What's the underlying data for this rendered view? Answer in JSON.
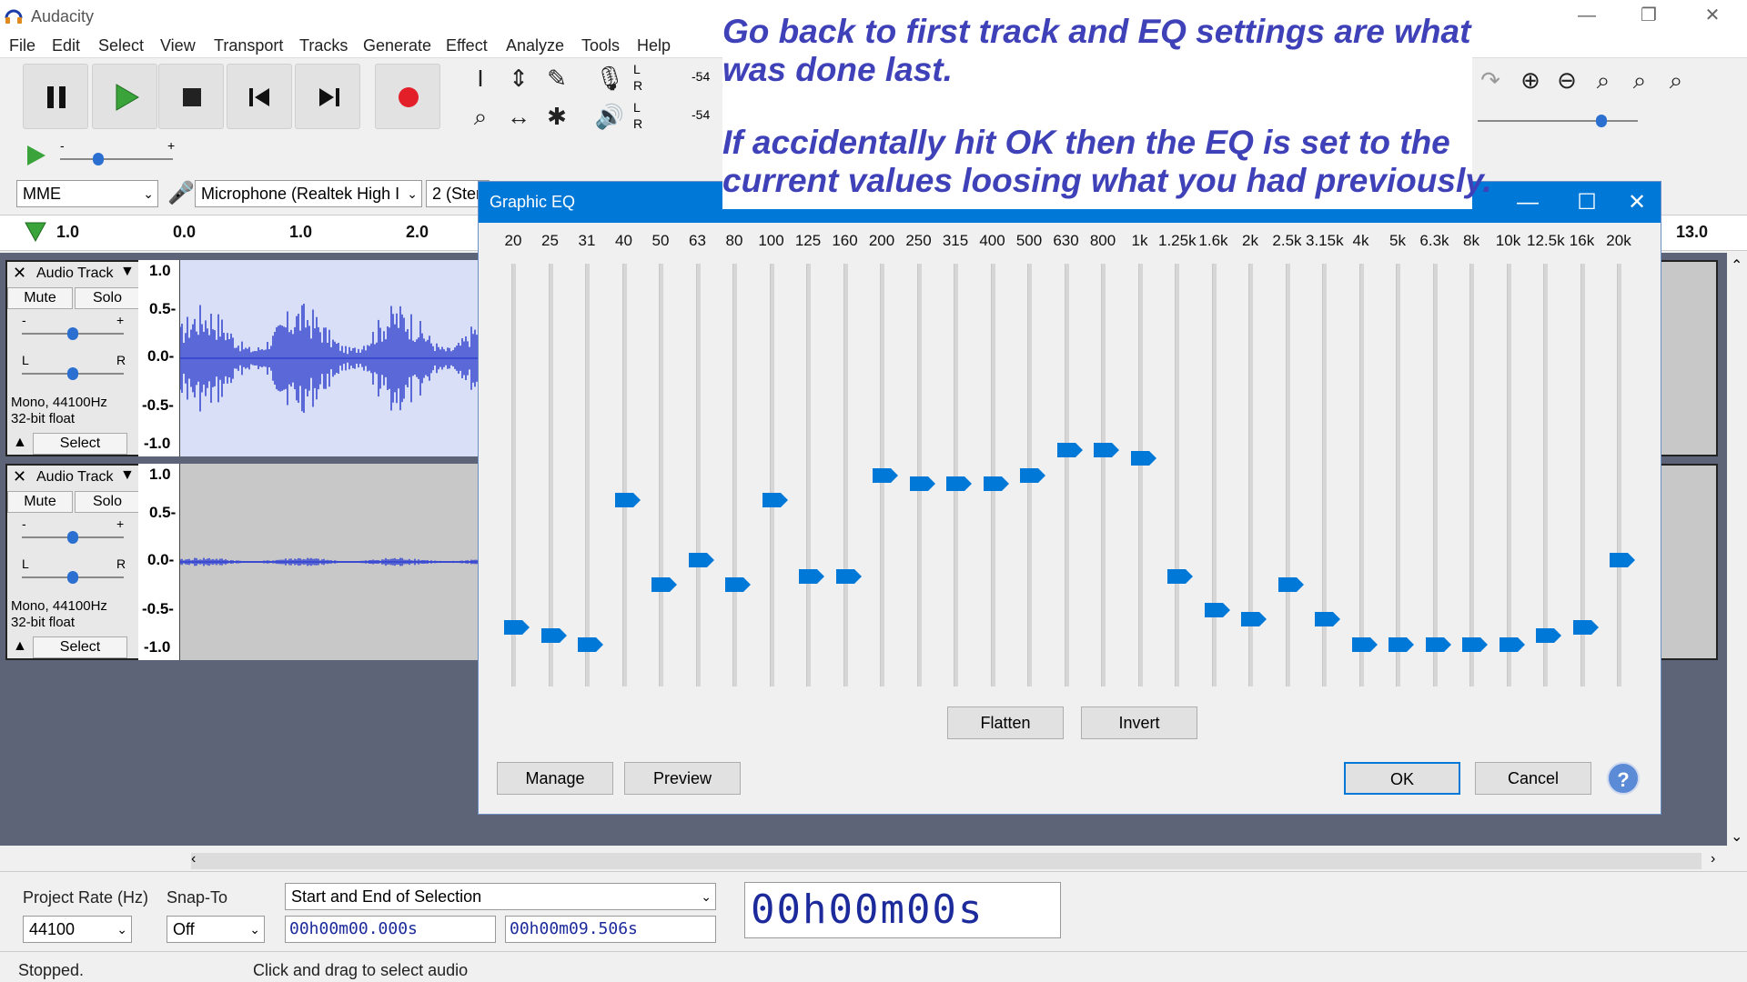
{
  "app": {
    "title": "Audacity"
  },
  "window_controls": {
    "minimize": "—",
    "restore": "❐",
    "close": "✕"
  },
  "menu": [
    "File",
    "Edit",
    "Select",
    "View",
    "Transport",
    "Tracks",
    "Generate",
    "Effect",
    "Analyze",
    "Tools",
    "Help"
  ],
  "meters": {
    "rec_level": "-54",
    "play_level": "-54",
    "L": "L",
    "R": "R"
  },
  "device": {
    "host": "MME",
    "mic": "Microphone (Realtek High I",
    "channels": "2 (Stere"
  },
  "ruler": {
    "labels": [
      "1.0",
      "0.0",
      "1.0",
      "2.0",
      "13.0"
    ]
  },
  "tracks": [
    {
      "name": "Audio Track",
      "mute": "Mute",
      "solo": "Solo",
      "info1": "Mono, 44100Hz",
      "info2": "32-bit float",
      "select": "Select",
      "y": [
        "1.0",
        "0.5-",
        "0.0-",
        "-0.5-",
        "-1.0"
      ]
    },
    {
      "name": "Audio Track",
      "mute": "Mute",
      "solo": "Solo",
      "info1": "Mono, 44100Hz",
      "info2": "32-bit float",
      "select": "Select",
      "y": [
        "1.0",
        "0.5-",
        "0.0-",
        "-0.5-",
        "-1.0"
      ]
    }
  ],
  "gain_slider": {
    "minus": "-",
    "plus": "+"
  },
  "pan_slider": {
    "L": "L",
    "R": "R"
  },
  "eq_dialog": {
    "title": "Graphic EQ",
    "controls": {
      "minimize": "—",
      "maximize": "☐",
      "close": "✕"
    },
    "bands": [
      {
        "label": "20",
        "level": 0.14
      },
      {
        "label": "25",
        "level": 0.12
      },
      {
        "label": "31",
        "level": 0.1
      },
      {
        "label": "40",
        "level": 0.44
      },
      {
        "label": "50",
        "level": 0.24
      },
      {
        "label": "63",
        "level": 0.3
      },
      {
        "label": "80",
        "level": 0.24
      },
      {
        "label": "100",
        "level": 0.44
      },
      {
        "label": "125",
        "level": 0.26
      },
      {
        "label": "160",
        "level": 0.26
      },
      {
        "label": "200",
        "level": 0.5
      },
      {
        "label": "250",
        "level": 0.48
      },
      {
        "label": "315",
        "level": 0.48
      },
      {
        "label": "400",
        "level": 0.48
      },
      {
        "label": "500",
        "level": 0.5
      },
      {
        "label": "630",
        "level": 0.56
      },
      {
        "label": "800",
        "level": 0.56
      },
      {
        "label": "1k",
        "level": 0.54
      },
      {
        "label": "1.25k",
        "level": 0.26
      },
      {
        "label": "1.6k",
        "level": 0.18
      },
      {
        "label": "2k",
        "level": 0.16
      },
      {
        "label": "2.5k",
        "level": 0.24
      },
      {
        "label": "3.15k",
        "level": 0.16
      },
      {
        "label": "4k",
        "level": 0.1
      },
      {
        "label": "5k",
        "level": 0.1
      },
      {
        "label": "6.3k",
        "level": 0.1
      },
      {
        "label": "8k",
        "level": 0.1
      },
      {
        "label": "10k",
        "level": 0.1
      },
      {
        "label": "12.5k",
        "level": 0.12
      },
      {
        "label": "16k",
        "level": 0.14
      },
      {
        "label": "20k",
        "level": 0.3
      }
    ],
    "flatten": "Flatten",
    "invert": "Invert",
    "manage": "Manage",
    "preview": "Preview",
    "ok": "OK",
    "cancel": "Cancel",
    "help": "?"
  },
  "annotation": {
    "line1": "Go back to first track and EQ settings are what",
    "line2": "was done last.",
    "line3": "If accidentally hit OK then the EQ is set to the",
    "line4": "current values loosing what you had previously."
  },
  "bottom": {
    "project_rate_label": "Project Rate (Hz)",
    "project_rate": "44100",
    "snap_label": "Snap-To",
    "snap": "Off",
    "selection_mode": "Start and End of Selection",
    "start_time": "00h00m00.000s",
    "end_time": "00h00m09.506s",
    "big_time": "00h00m00s"
  },
  "status": {
    "state": "Stopped.",
    "hint": "Click and drag to select audio"
  },
  "colors": {
    "accent": "#0078d7",
    "record": "#e3202a",
    "play": "#3aa33a",
    "wave": "#3b4bd1",
    "annotation": "#3f41b8"
  }
}
